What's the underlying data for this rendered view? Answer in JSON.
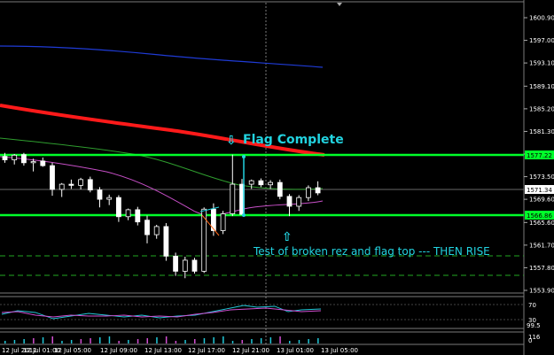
{
  "price_axis": {
    "ticks": [
      "1600.90",
      "1597.00",
      "1593.10",
      "1589.10",
      "1585.20",
      "1581.30",
      "1577.40",
      "1573.50",
      "1569.60",
      "1565.60",
      "1561.70",
      "1557.80",
      "1553.90"
    ],
    "tick_values": [
      1600.9,
      1597.0,
      1593.1,
      1589.1,
      1585.2,
      1581.3,
      1577.4,
      1573.5,
      1569.6,
      1565.6,
      1561.7,
      1557.8,
      1553.9
    ],
    "min": 1552.9,
    "max": 1602.5
  },
  "price_labels": {
    "resistance": "1577.22",
    "support": "1566.86",
    "current": "1571.34"
  },
  "time_axis": {
    "labels": [
      "12 Jul 2012",
      "12 Jul 01:00",
      "12 Jul 05:00",
      "12 Jul 09:00",
      "12 Jul 13:00",
      "12 Jul 17:00",
      "12 Jul 21:00",
      "13 Jul 01:00",
      "13 Jul 05:00"
    ]
  },
  "indicator_axis": {
    "labels": [
      "70",
      "30",
      "99.5",
      "116",
      "0"
    ]
  },
  "annotations": {
    "flag_complete": "Flag Complete",
    "test_text": "Test of broken rez and flag top --- THEN RISE",
    "down_arrow": "⇩",
    "up_arrow": "⇧"
  },
  "colors": {
    "background": "#000000",
    "level_line": "#00ff2a",
    "ma_red": "#ff1a1a",
    "ma_blue": "#1f3bd6",
    "ma_green": "#2f9e2f",
    "ma_magenta": "#c74fc7",
    "annotation": "#22d3e0",
    "candle": "#ffffff"
  },
  "chart_data": {
    "type": "candlestick",
    "candles": [
      {
        "o": 1577.0,
        "h": 1577.6,
        "l": 1575.9,
        "c": 1576.4
      },
      {
        "o": 1576.4,
        "h": 1577.4,
        "l": 1575.6,
        "c": 1577.2
      },
      {
        "o": 1577.3,
        "h": 1577.6,
        "l": 1575.4,
        "c": 1575.9
      },
      {
        "o": 1575.9,
        "h": 1576.6,
        "l": 1574.4,
        "c": 1576.1
      },
      {
        "o": 1576.2,
        "h": 1576.8,
        "l": 1575.2,
        "c": 1575.4
      },
      {
        "o": 1575.4,
        "h": 1575.9,
        "l": 1570.2,
        "c": 1571.3
      },
      {
        "o": 1571.3,
        "h": 1572.4,
        "l": 1570.0,
        "c": 1572.2
      },
      {
        "o": 1572.2,
        "h": 1573.0,
        "l": 1571.4,
        "c": 1572.0
      },
      {
        "o": 1572.0,
        "h": 1573.3,
        "l": 1571.3,
        "c": 1573.0
      },
      {
        "o": 1573.0,
        "h": 1573.5,
        "l": 1570.8,
        "c": 1571.2
      },
      {
        "o": 1571.2,
        "h": 1571.7,
        "l": 1568.2,
        "c": 1569.6
      },
      {
        "o": 1569.6,
        "h": 1570.4,
        "l": 1568.6,
        "c": 1569.9
      },
      {
        "o": 1569.9,
        "h": 1570.3,
        "l": 1565.7,
        "c": 1566.6
      },
      {
        "o": 1566.6,
        "h": 1568.0,
        "l": 1566.0,
        "c": 1567.8
      },
      {
        "o": 1567.8,
        "h": 1568.3,
        "l": 1565.1,
        "c": 1565.7
      },
      {
        "o": 1566.0,
        "h": 1566.8,
        "l": 1562.0,
        "c": 1563.5
      },
      {
        "o": 1563.5,
        "h": 1565.2,
        "l": 1562.8,
        "c": 1564.9
      },
      {
        "o": 1564.9,
        "h": 1565.5,
        "l": 1559.0,
        "c": 1559.8
      },
      {
        "o": 1559.8,
        "h": 1560.4,
        "l": 1556.4,
        "c": 1557.2
      },
      {
        "o": 1557.2,
        "h": 1559.7,
        "l": 1556.0,
        "c": 1559.1
      },
      {
        "o": 1559.1,
        "h": 1559.5,
        "l": 1556.8,
        "c": 1557.2
      },
      {
        "o": 1557.2,
        "h": 1568.2,
        "l": 1556.9,
        "c": 1567.9
      },
      {
        "o": 1567.9,
        "h": 1568.9,
        "l": 1563.3,
        "c": 1564.2
      },
      {
        "o": 1564.2,
        "h": 1567.6,
        "l": 1563.6,
        "c": 1567.1
      },
      {
        "o": 1567.1,
        "h": 1577.3,
        "l": 1566.7,
        "c": 1572.2
      },
      {
        "o": 1572.2,
        "h": 1573.1,
        "l": 1566.9,
        "c": 1567.0
      },
      {
        "o": 1572.2,
        "h": 1573.0,
        "l": 1571.4,
        "c": 1572.8
      },
      {
        "o": 1572.8,
        "h": 1573.2,
        "l": 1571.7,
        "c": 1572.1
      },
      {
        "o": 1572.1,
        "h": 1572.9,
        "l": 1571.4,
        "c": 1572.5
      },
      {
        "o": 1572.5,
        "h": 1573.0,
        "l": 1569.6,
        "c": 1570.1
      },
      {
        "o": 1570.1,
        "h": 1570.5,
        "l": 1566.7,
        "c": 1568.4
      },
      {
        "o": 1568.4,
        "h": 1570.3,
        "l": 1567.6,
        "c": 1569.9
      },
      {
        "o": 1569.9,
        "h": 1572.0,
        "l": 1569.3,
        "c": 1571.6
      },
      {
        "o": 1571.6,
        "h": 1572.7,
        "l": 1570.3,
        "c": 1570.7
      }
    ]
  }
}
